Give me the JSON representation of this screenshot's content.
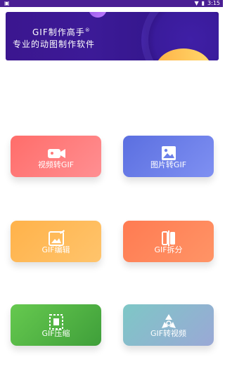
{
  "status_bar": {
    "time": "3:15",
    "left_icon": "notification-icon",
    "right_icons": [
      "wifi-icon",
      "battery-icon"
    ]
  },
  "banner": {
    "title": "GIF制作高手",
    "subtitle": "专业的动图制作软件",
    "mark": "®"
  },
  "features": [
    {
      "label": "视频转GIF",
      "icon": "video-camera-icon",
      "color": "#ff7a78"
    },
    {
      "label": "图片转GIF",
      "icon": "image-icon",
      "color": "#6b7fe9"
    },
    {
      "label": "GIF编辑",
      "icon": "edit-image-icon",
      "color": "#ffb85a"
    },
    {
      "label": "GIF拆分",
      "icon": "split-icon",
      "color": "#ff8558"
    },
    {
      "label": "GIF压缩",
      "icon": "compress-icon",
      "color": "#4fb045"
    },
    {
      "label": "GIF转视频",
      "icon": "recycle-arrows-icon",
      "color": "#8fb6d2"
    }
  ]
}
